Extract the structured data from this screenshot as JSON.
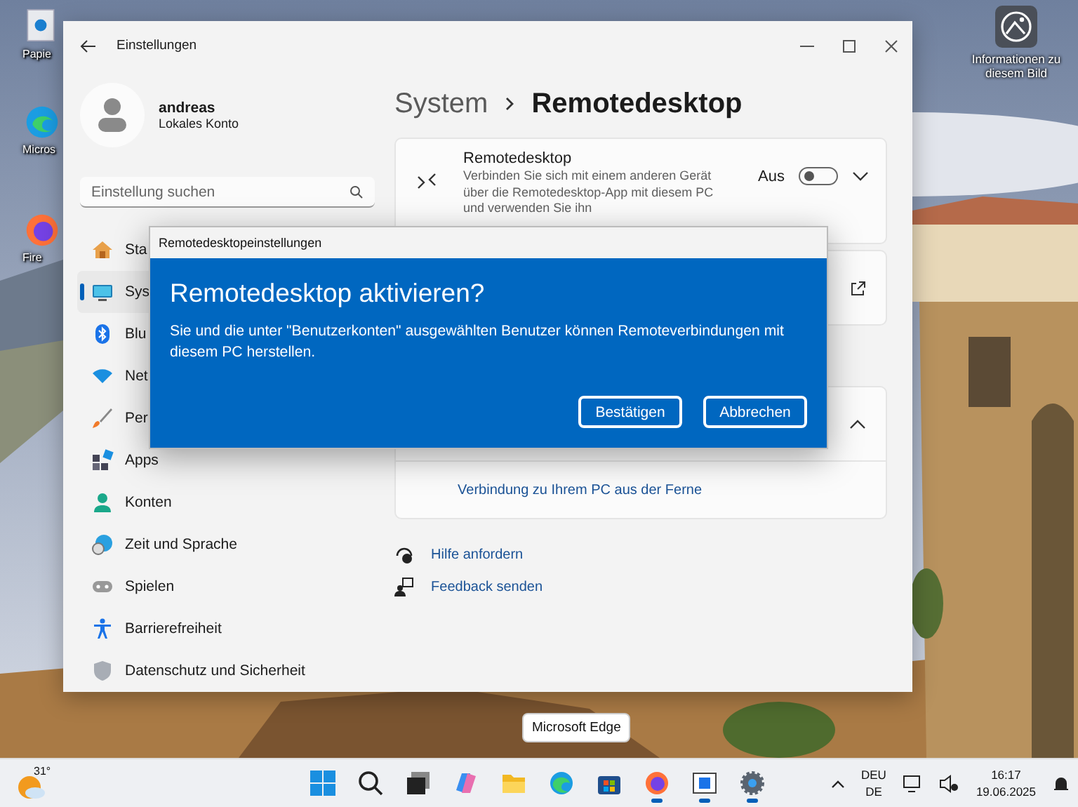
{
  "desktop": {
    "icons": [
      {
        "kind": "paper",
        "label": "Papie"
      },
      {
        "kind": "edge",
        "label": "Micros"
      },
      {
        "kind": "firefox",
        "label": "Fire"
      }
    ],
    "info_icon": {
      "label": "Informationen zu diesem Bild"
    }
  },
  "window": {
    "title": "Einstellungen",
    "user": {
      "name": "andreas",
      "account": "Lokales Konto"
    },
    "search": {
      "placeholder": "Einstellung suchen"
    },
    "sidebar": {
      "items": [
        {
          "kind": "home",
          "label": "Sta",
          "selected": false
        },
        {
          "kind": "system",
          "label": "Sys",
          "selected": true
        },
        {
          "kind": "bluetooth",
          "label": "Blu",
          "selected": false
        },
        {
          "kind": "network",
          "label": "Net",
          "selected": false
        },
        {
          "kind": "brush",
          "label": "Per",
          "selected": false
        },
        {
          "kind": "apps",
          "label": "Apps",
          "selected": false
        },
        {
          "kind": "account",
          "label": "Konten",
          "selected": false
        },
        {
          "kind": "time",
          "label": "Zeit und Sprache",
          "selected": false
        },
        {
          "kind": "gaming",
          "label": "Spielen",
          "selected": false
        },
        {
          "kind": "accessibility",
          "label": "Barrierefreiheit",
          "selected": false
        },
        {
          "kind": "privacy",
          "label": "Datenschutz und Sicherheit",
          "selected": false
        }
      ]
    },
    "breadcrumb": [
      "System",
      "Remotedesktop"
    ],
    "remote_card": {
      "title": "Remotedesktop",
      "description": "Verbinden Sie sich mit einem anderen Gerät über die Remotedesktop-App mit diesem PC und verwenden Sie ihn",
      "state_label": "Aus",
      "on": false,
      "expanded": false
    },
    "expander": {
      "expanded": true,
      "link": "Verbindung zu Ihrem PC aus der Ferne"
    },
    "help_links": [
      "Hilfe anfordern",
      "Feedback senden"
    ]
  },
  "dialog": {
    "title": "Remotedesktopeinstellungen",
    "heading": "Remotedesktop aktivieren?",
    "message": "Sie und die unter \"Benutzerkonten\" ausgewählten Benutzer können Remoteverbindungen mit diesem PC herstellen.",
    "buttons": [
      "Bestätigen",
      "Abbrechen"
    ]
  },
  "tooltip": "Microsoft Edge",
  "taskbar": {
    "weather": "31°",
    "apps": [
      {
        "kind": "start",
        "running": false
      },
      {
        "kind": "search",
        "running": false
      },
      {
        "kind": "taskview",
        "running": false
      },
      {
        "kind": "copilot",
        "running": false
      },
      {
        "kind": "explorer",
        "running": false
      },
      {
        "kind": "edge",
        "running": false
      },
      {
        "kind": "store",
        "running": false
      },
      {
        "kind": "firefox",
        "running": true
      },
      {
        "kind": "window",
        "running": true
      },
      {
        "kind": "settings",
        "running": true
      }
    ],
    "language": [
      "DEU",
      "DE"
    ],
    "time": "16:17",
    "date": "19.06.2025"
  }
}
